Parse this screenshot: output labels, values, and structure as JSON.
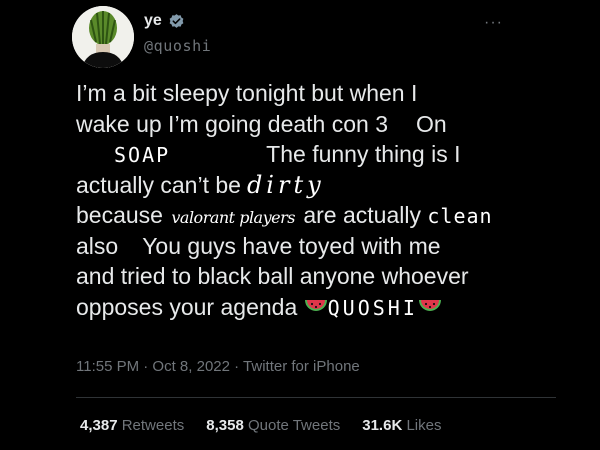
{
  "user": {
    "display_name": "ye",
    "handle": "@quoshi"
  },
  "more_label": "···",
  "tweet": {
    "l1": "I’m a bit sleepy tonight but when I",
    "l2a": "wake up I’m going death con 3",
    "l2b": "On",
    "soap": "SOAP",
    "l3b": "The funny thing is I",
    "l4a": "actually can’t be",
    "dirty": "dirty",
    "l5a": "because",
    "valorant": "valorant players",
    "l5b": "are actually",
    "clean": "clean",
    "l6a": "also",
    "l6b": "You guys have toyed with me",
    "l7": "and tried to black ball anyone whoever",
    "l8a": "opposes your agenda",
    "quoshi": "QUOSHI"
  },
  "meta": {
    "time": "11:55 PM · Oct 8, 2022 · Twitter for iPhone"
  },
  "stats": {
    "retweets_num": "4,387",
    "retweets_label": "Retweets",
    "quotes_num": "8,358",
    "quotes_label": "Quote Tweets",
    "likes_num": "31.6K",
    "likes_label": "Likes"
  },
  "colors": {
    "background": "#000000",
    "text": "#e7e9ea",
    "muted": "#71767b",
    "verified": "#829aab",
    "watermelon_red": "#e0364a",
    "watermelon_green": "#4caf50"
  }
}
